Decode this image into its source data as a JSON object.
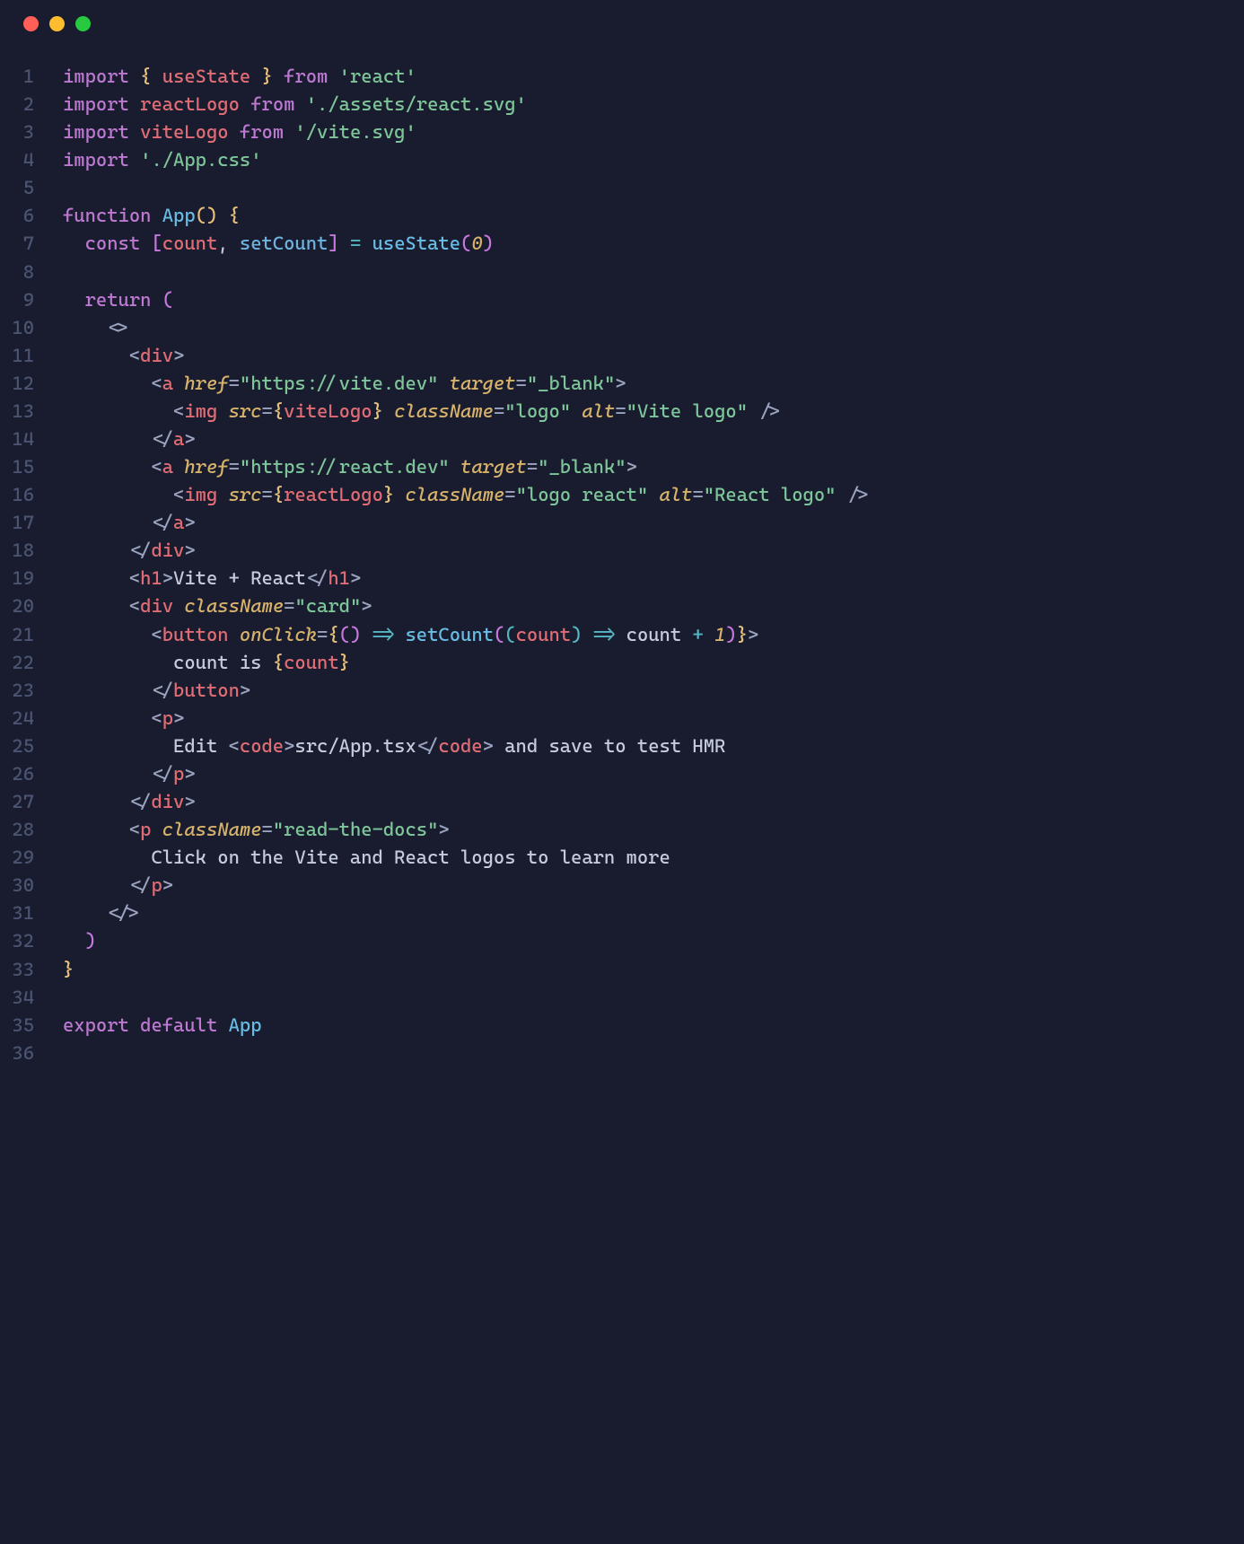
{
  "traffic_lights": {
    "red": "#ff5f56",
    "yellow": "#ffbd2e",
    "green": "#27c93f"
  },
  "code": {
    "lines": [
      {
        "n": 1,
        "tokens": [
          {
            "c": "kw",
            "t": "import"
          },
          {
            "c": "pn",
            "t": " "
          },
          {
            "c": "bri",
            "t": "{"
          },
          {
            "c": "pn",
            "t": " "
          },
          {
            "c": "id",
            "t": "useState"
          },
          {
            "c": "pn",
            "t": " "
          },
          {
            "c": "bri",
            "t": "}"
          },
          {
            "c": "pn",
            "t": " "
          },
          {
            "c": "kw",
            "t": "from"
          },
          {
            "c": "pn",
            "t": " "
          },
          {
            "c": "str",
            "t": "'react'"
          }
        ]
      },
      {
        "n": 2,
        "tokens": [
          {
            "c": "kw",
            "t": "import"
          },
          {
            "c": "pn",
            "t": " "
          },
          {
            "c": "id",
            "t": "reactLogo"
          },
          {
            "c": "pn",
            "t": " "
          },
          {
            "c": "kw",
            "t": "from"
          },
          {
            "c": "pn",
            "t": " "
          },
          {
            "c": "str",
            "t": "'./assets/react.svg'"
          }
        ]
      },
      {
        "n": 3,
        "tokens": [
          {
            "c": "kw",
            "t": "import"
          },
          {
            "c": "pn",
            "t": " "
          },
          {
            "c": "id",
            "t": "viteLogo"
          },
          {
            "c": "pn",
            "t": " "
          },
          {
            "c": "kw",
            "t": "from"
          },
          {
            "c": "pn",
            "t": " "
          },
          {
            "c": "str",
            "t": "'/vite.svg'"
          }
        ]
      },
      {
        "n": 4,
        "tokens": [
          {
            "c": "kw",
            "t": "import"
          },
          {
            "c": "pn",
            "t": " "
          },
          {
            "c": "str",
            "t": "'./App.css'"
          }
        ]
      },
      {
        "n": 5,
        "tokens": []
      },
      {
        "n": 6,
        "tokens": [
          {
            "c": "kw",
            "t": "function"
          },
          {
            "c": "pn",
            "t": " "
          },
          {
            "c": "fn",
            "t": "App"
          },
          {
            "c": "bri",
            "t": "()"
          },
          {
            "c": "pn",
            "t": " "
          },
          {
            "c": "bri",
            "t": "{"
          }
        ]
      },
      {
        "n": 7,
        "tokens": [
          {
            "c": "pn",
            "t": "  "
          },
          {
            "c": "kw",
            "t": "const"
          },
          {
            "c": "pn",
            "t": " "
          },
          {
            "c": "bri2",
            "t": "["
          },
          {
            "c": "id",
            "t": "count"
          },
          {
            "c": "pn",
            "t": ", "
          },
          {
            "c": "hook",
            "t": "setCount"
          },
          {
            "c": "bri2",
            "t": "]"
          },
          {
            "c": "pn",
            "t": " "
          },
          {
            "c": "op",
            "t": "="
          },
          {
            "c": "pn",
            "t": " "
          },
          {
            "c": "fn",
            "t": "useState"
          },
          {
            "c": "bri2",
            "t": "("
          },
          {
            "c": "num",
            "t": "0"
          },
          {
            "c": "bri2",
            "t": ")"
          }
        ]
      },
      {
        "n": 8,
        "tokens": []
      },
      {
        "n": 9,
        "tokens": [
          {
            "c": "pn",
            "t": "  "
          },
          {
            "c": "kw",
            "t": "return"
          },
          {
            "c": "pn",
            "t": " "
          },
          {
            "c": "bri2",
            "t": "("
          }
        ]
      },
      {
        "n": 10,
        "tokens": [
          {
            "c": "pn",
            "t": "    "
          },
          {
            "c": "tagp",
            "t": "<>"
          }
        ]
      },
      {
        "n": 11,
        "tokens": [
          {
            "c": "pn",
            "t": "      "
          },
          {
            "c": "tagp",
            "t": "<"
          },
          {
            "c": "tag",
            "t": "div"
          },
          {
            "c": "tagp",
            "t": ">"
          }
        ]
      },
      {
        "n": 12,
        "tokens": [
          {
            "c": "pn",
            "t": "        "
          },
          {
            "c": "tagp",
            "t": "<"
          },
          {
            "c": "tag",
            "t": "a"
          },
          {
            "c": "pn",
            "t": " "
          },
          {
            "c": "attr",
            "t": "href"
          },
          {
            "c": "tagp",
            "t": "="
          },
          {
            "c": "str",
            "t": "\"https://vite.dev\""
          },
          {
            "c": "pn",
            "t": " "
          },
          {
            "c": "attr",
            "t": "target"
          },
          {
            "c": "tagp",
            "t": "="
          },
          {
            "c": "str",
            "t": "\"_blank\""
          },
          {
            "c": "tagp",
            "t": ">"
          }
        ]
      },
      {
        "n": 13,
        "tokens": [
          {
            "c": "pn",
            "t": "          "
          },
          {
            "c": "tagp",
            "t": "<"
          },
          {
            "c": "tag",
            "t": "img"
          },
          {
            "c": "pn",
            "t": " "
          },
          {
            "c": "attr",
            "t": "src"
          },
          {
            "c": "tagp",
            "t": "="
          },
          {
            "c": "bri",
            "t": "{"
          },
          {
            "c": "id",
            "t": "viteLogo"
          },
          {
            "c": "bri",
            "t": "}"
          },
          {
            "c": "pn",
            "t": " "
          },
          {
            "c": "attr",
            "t": "className"
          },
          {
            "c": "tagp",
            "t": "="
          },
          {
            "c": "str",
            "t": "\"logo\""
          },
          {
            "c": "pn",
            "t": " "
          },
          {
            "c": "attr",
            "t": "alt"
          },
          {
            "c": "tagp",
            "t": "="
          },
          {
            "c": "str",
            "t": "\"Vite logo\""
          },
          {
            "c": "pn",
            "t": " "
          },
          {
            "c": "tagp",
            "t": "/>"
          }
        ]
      },
      {
        "n": 14,
        "tokens": [
          {
            "c": "pn",
            "t": "        "
          },
          {
            "c": "tagp",
            "t": "</"
          },
          {
            "c": "tag",
            "t": "a"
          },
          {
            "c": "tagp",
            "t": ">"
          }
        ]
      },
      {
        "n": 15,
        "tokens": [
          {
            "c": "pn",
            "t": "        "
          },
          {
            "c": "tagp",
            "t": "<"
          },
          {
            "c": "tag",
            "t": "a"
          },
          {
            "c": "pn",
            "t": " "
          },
          {
            "c": "attr",
            "t": "href"
          },
          {
            "c": "tagp",
            "t": "="
          },
          {
            "c": "str",
            "t": "\"https://react.dev\""
          },
          {
            "c": "pn",
            "t": " "
          },
          {
            "c": "attr",
            "t": "target"
          },
          {
            "c": "tagp",
            "t": "="
          },
          {
            "c": "str",
            "t": "\"_blank\""
          },
          {
            "c": "tagp",
            "t": ">"
          }
        ]
      },
      {
        "n": 16,
        "tokens": [
          {
            "c": "pn",
            "t": "          "
          },
          {
            "c": "tagp",
            "t": "<"
          },
          {
            "c": "tag",
            "t": "img"
          },
          {
            "c": "pn",
            "t": " "
          },
          {
            "c": "attr",
            "t": "src"
          },
          {
            "c": "tagp",
            "t": "="
          },
          {
            "c": "bri",
            "t": "{"
          },
          {
            "c": "id",
            "t": "reactLogo"
          },
          {
            "c": "bri",
            "t": "}"
          },
          {
            "c": "pn",
            "t": " "
          },
          {
            "c": "attr",
            "t": "className"
          },
          {
            "c": "tagp",
            "t": "="
          },
          {
            "c": "str",
            "t": "\"logo react\""
          },
          {
            "c": "pn",
            "t": " "
          },
          {
            "c": "attr",
            "t": "alt"
          },
          {
            "c": "tagp",
            "t": "="
          },
          {
            "c": "str",
            "t": "\"React logo\""
          },
          {
            "c": "pn",
            "t": " "
          },
          {
            "c": "tagp",
            "t": "/>"
          }
        ]
      },
      {
        "n": 17,
        "tokens": [
          {
            "c": "pn",
            "t": "        "
          },
          {
            "c": "tagp",
            "t": "</"
          },
          {
            "c": "tag",
            "t": "a"
          },
          {
            "c": "tagp",
            "t": ">"
          }
        ]
      },
      {
        "n": 18,
        "tokens": [
          {
            "c": "pn",
            "t": "      "
          },
          {
            "c": "tagp",
            "t": "</"
          },
          {
            "c": "tag",
            "t": "div"
          },
          {
            "c": "tagp",
            "t": ">"
          }
        ]
      },
      {
        "n": 19,
        "tokens": [
          {
            "c": "pn",
            "t": "      "
          },
          {
            "c": "tagp",
            "t": "<"
          },
          {
            "c": "tag",
            "t": "h1"
          },
          {
            "c": "tagp",
            "t": ">"
          },
          {
            "c": "txt",
            "t": "Vite + React"
          },
          {
            "c": "tagp",
            "t": "</"
          },
          {
            "c": "tag",
            "t": "h1"
          },
          {
            "c": "tagp",
            "t": ">"
          }
        ]
      },
      {
        "n": 20,
        "tokens": [
          {
            "c": "pn",
            "t": "      "
          },
          {
            "c": "tagp",
            "t": "<"
          },
          {
            "c": "tag",
            "t": "div"
          },
          {
            "c": "pn",
            "t": " "
          },
          {
            "c": "attr",
            "t": "className"
          },
          {
            "c": "tagp",
            "t": "="
          },
          {
            "c": "str",
            "t": "\"card\""
          },
          {
            "c": "tagp",
            "t": ">"
          }
        ]
      },
      {
        "n": 21,
        "tokens": [
          {
            "c": "pn",
            "t": "        "
          },
          {
            "c": "tagp",
            "t": "<"
          },
          {
            "c": "tag",
            "t": "button"
          },
          {
            "c": "pn",
            "t": " "
          },
          {
            "c": "attr",
            "t": "onClick"
          },
          {
            "c": "tagp",
            "t": "="
          },
          {
            "c": "bri",
            "t": "{"
          },
          {
            "c": "bri2",
            "t": "()"
          },
          {
            "c": "pn",
            "t": " "
          },
          {
            "c": "op",
            "t": "=>"
          },
          {
            "c": "pn",
            "t": " "
          },
          {
            "c": "fn",
            "t": "setCount"
          },
          {
            "c": "bri2",
            "t": "("
          },
          {
            "c": "bri3",
            "t": "("
          },
          {
            "c": "id",
            "t": "count"
          },
          {
            "c": "bri3",
            "t": ")"
          },
          {
            "c": "pn",
            "t": " "
          },
          {
            "c": "op",
            "t": "=>"
          },
          {
            "c": "pn",
            "t": " "
          },
          {
            "c": "txt",
            "t": "count "
          },
          {
            "c": "op",
            "t": "+"
          },
          {
            "c": "pn",
            "t": " "
          },
          {
            "c": "num",
            "t": "1"
          },
          {
            "c": "bri2",
            "t": ")"
          },
          {
            "c": "bri",
            "t": "}"
          },
          {
            "c": "tagp",
            "t": ">"
          }
        ]
      },
      {
        "n": 22,
        "tokens": [
          {
            "c": "pn",
            "t": "          "
          },
          {
            "c": "txt",
            "t": "count is "
          },
          {
            "c": "bri",
            "t": "{"
          },
          {
            "c": "id",
            "t": "count"
          },
          {
            "c": "bri",
            "t": "}"
          }
        ]
      },
      {
        "n": 23,
        "tokens": [
          {
            "c": "pn",
            "t": "        "
          },
          {
            "c": "tagp",
            "t": "</"
          },
          {
            "c": "tag",
            "t": "button"
          },
          {
            "c": "tagp",
            "t": ">"
          }
        ]
      },
      {
        "n": 24,
        "tokens": [
          {
            "c": "pn",
            "t": "        "
          },
          {
            "c": "tagp",
            "t": "<"
          },
          {
            "c": "tag",
            "t": "p"
          },
          {
            "c": "tagp",
            "t": ">"
          }
        ]
      },
      {
        "n": 25,
        "tokens": [
          {
            "c": "pn",
            "t": "          "
          },
          {
            "c": "txt",
            "t": "Edit "
          },
          {
            "c": "tagp",
            "t": "<"
          },
          {
            "c": "tag",
            "t": "code"
          },
          {
            "c": "tagp",
            "t": ">"
          },
          {
            "c": "txt",
            "t": "src/App.tsx"
          },
          {
            "c": "tagp",
            "t": "</"
          },
          {
            "c": "tag",
            "t": "code"
          },
          {
            "c": "tagp",
            "t": ">"
          },
          {
            "c": "txt",
            "t": " and save to test HMR"
          }
        ]
      },
      {
        "n": 26,
        "tokens": [
          {
            "c": "pn",
            "t": "        "
          },
          {
            "c": "tagp",
            "t": "</"
          },
          {
            "c": "tag",
            "t": "p"
          },
          {
            "c": "tagp",
            "t": ">"
          }
        ]
      },
      {
        "n": 27,
        "tokens": [
          {
            "c": "pn",
            "t": "      "
          },
          {
            "c": "tagp",
            "t": "</"
          },
          {
            "c": "tag",
            "t": "div"
          },
          {
            "c": "tagp",
            "t": ">"
          }
        ]
      },
      {
        "n": 28,
        "tokens": [
          {
            "c": "pn",
            "t": "      "
          },
          {
            "c": "tagp",
            "t": "<"
          },
          {
            "c": "tag",
            "t": "p"
          },
          {
            "c": "pn",
            "t": " "
          },
          {
            "c": "attr",
            "t": "className"
          },
          {
            "c": "tagp",
            "t": "="
          },
          {
            "c": "str",
            "t": "\"read-the-docs\""
          },
          {
            "c": "tagp",
            "t": ">"
          }
        ]
      },
      {
        "n": 29,
        "tokens": [
          {
            "c": "pn",
            "t": "        "
          },
          {
            "c": "txt",
            "t": "Click on the Vite and React logos to learn more"
          }
        ]
      },
      {
        "n": 30,
        "tokens": [
          {
            "c": "pn",
            "t": "      "
          },
          {
            "c": "tagp",
            "t": "</"
          },
          {
            "c": "tag",
            "t": "p"
          },
          {
            "c": "tagp",
            "t": ">"
          }
        ]
      },
      {
        "n": 31,
        "tokens": [
          {
            "c": "pn",
            "t": "    "
          },
          {
            "c": "tagp",
            "t": "</>"
          }
        ]
      },
      {
        "n": 32,
        "tokens": [
          {
            "c": "pn",
            "t": "  "
          },
          {
            "c": "bri2",
            "t": ")"
          }
        ]
      },
      {
        "n": 33,
        "tokens": [
          {
            "c": "bri",
            "t": "}"
          }
        ]
      },
      {
        "n": 34,
        "tokens": []
      },
      {
        "n": 35,
        "tokens": [
          {
            "c": "kw",
            "t": "export"
          },
          {
            "c": "pn",
            "t": " "
          },
          {
            "c": "kw",
            "t": "default"
          },
          {
            "c": "pn",
            "t": " "
          },
          {
            "c": "fn",
            "t": "App"
          }
        ]
      },
      {
        "n": 36,
        "tokens": []
      }
    ]
  }
}
